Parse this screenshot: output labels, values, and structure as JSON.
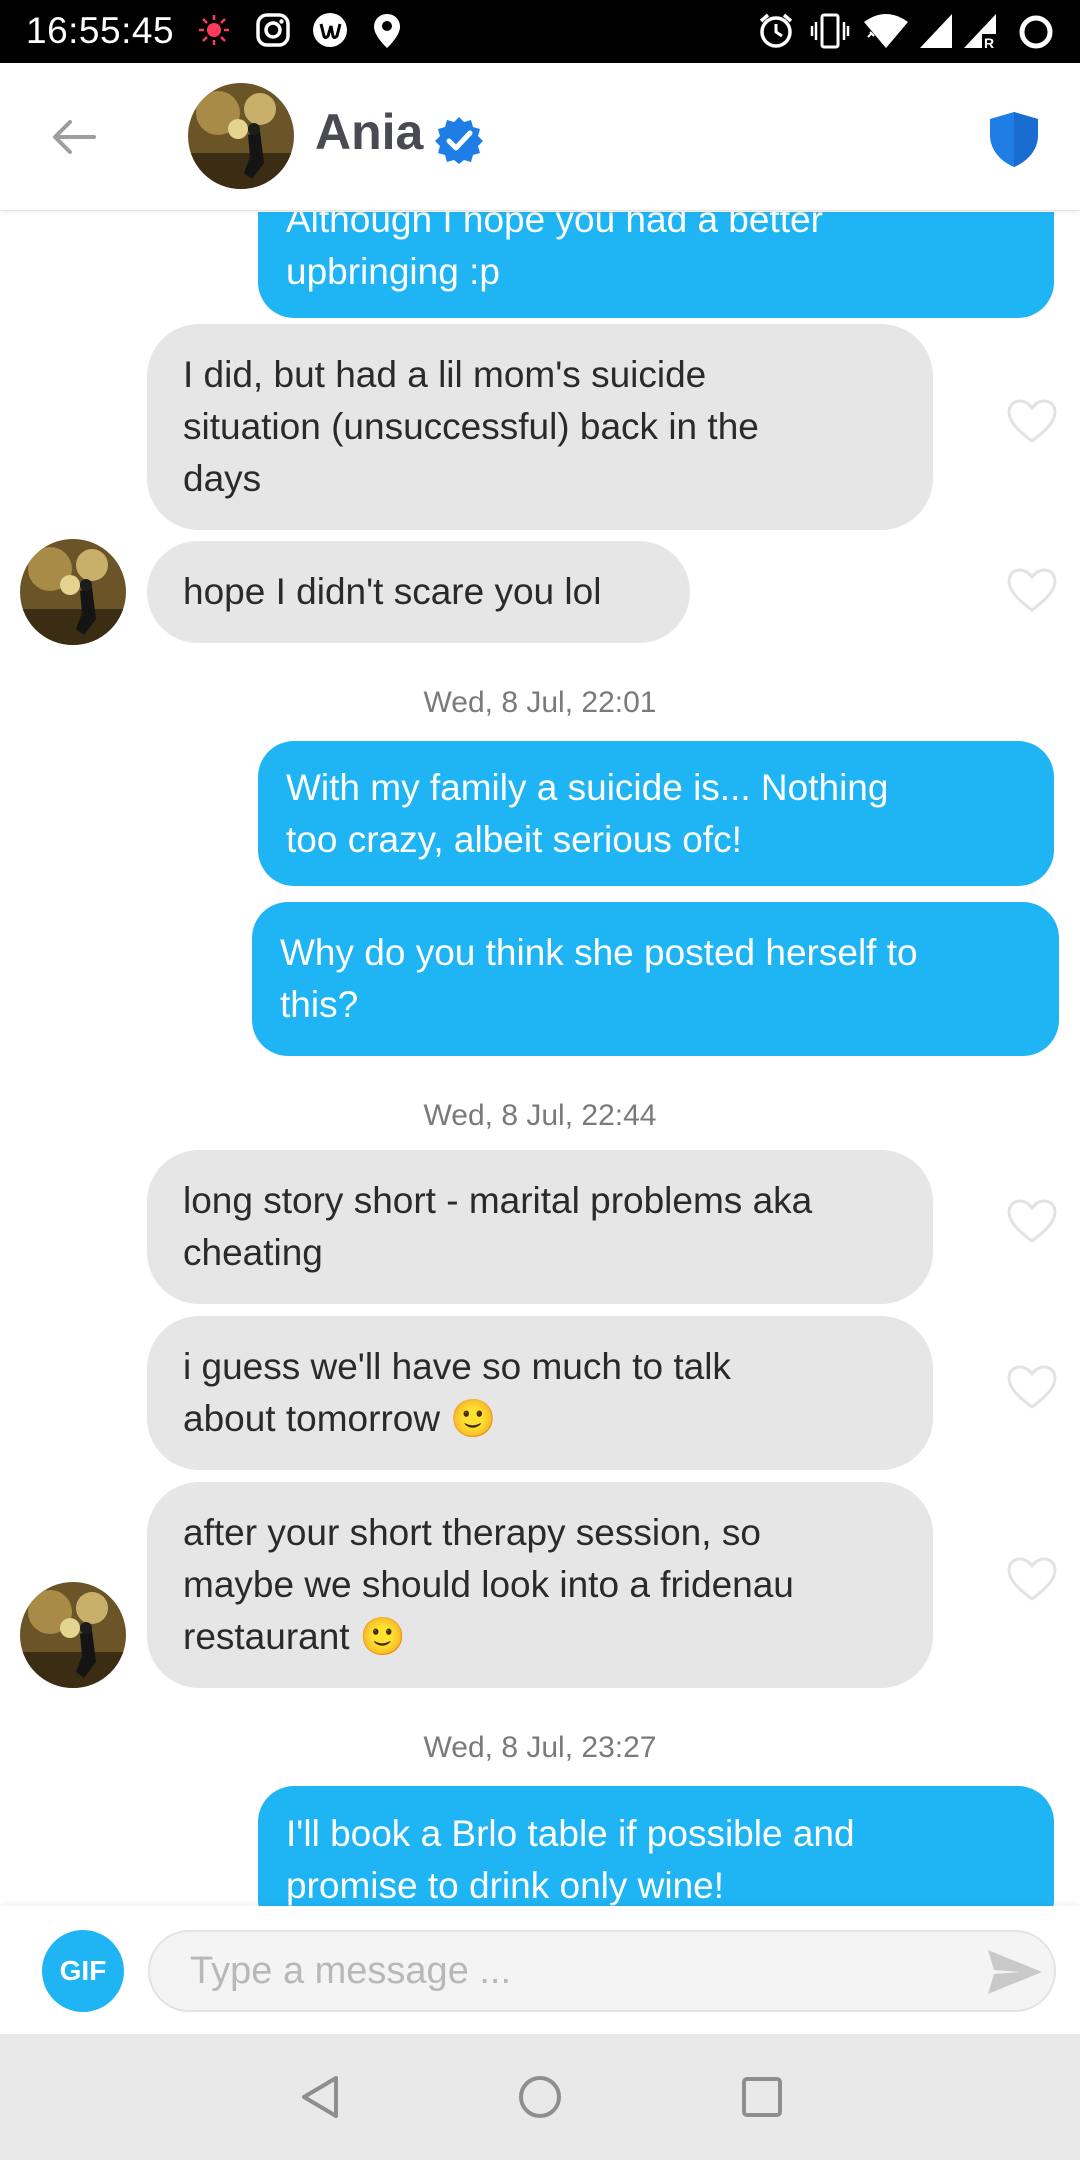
{
  "status_bar": {
    "time": "16:55:45",
    "icons": [
      "sun-icon",
      "instagram-icon",
      "app-u-icon",
      "location-pin-icon",
      "alarm-icon",
      "vibrate-icon",
      "wifi-icon",
      "signal-icon",
      "signal-roaming-icon",
      "battery-ring-icon"
    ]
  },
  "header": {
    "contact_name": "Ania",
    "verified": true,
    "accent_color": "#1f7de6"
  },
  "colors": {
    "sent_bubble": "#1fb5f5",
    "received_bubble": "#e6e6e6",
    "gif_button": "#1fb5f5"
  },
  "chat": {
    "top_partial_sent": "Although I hope you had a better\nupbringing :p",
    "msg1": "I did, but had a lil mom's suicide\nsituation (unsuccessful) back in the\ndays",
    "msg2": "hope I didn't scare you lol",
    "ts1": "Wed, 8 Jul, 22:01",
    "msg3": "With my family a suicide is... Nothing\ntoo crazy, albeit serious ofc!",
    "msg4": "Why do you think she posted herself to\nthis?",
    "ts2": "Wed, 8 Jul, 22:44",
    "msg5": "long story short - marital problems aka\ncheating",
    "msg6": "i guess we'll have so much to talk\nabout tomorrow 🙂",
    "msg7": "after your short therapy session, so\nmaybe we should look into a fridenau\nrestaurant 🙂",
    "ts3": "Wed, 8 Jul, 23:27",
    "msg8": "I'll book a Brlo table if possible and\npromise to drink only wine!"
  },
  "composer": {
    "gif_label": "GIF",
    "placeholder": "Type a message ..."
  },
  "nav": {
    "icons": [
      "back-triangle-icon",
      "home-circle-icon",
      "recents-square-icon"
    ]
  }
}
